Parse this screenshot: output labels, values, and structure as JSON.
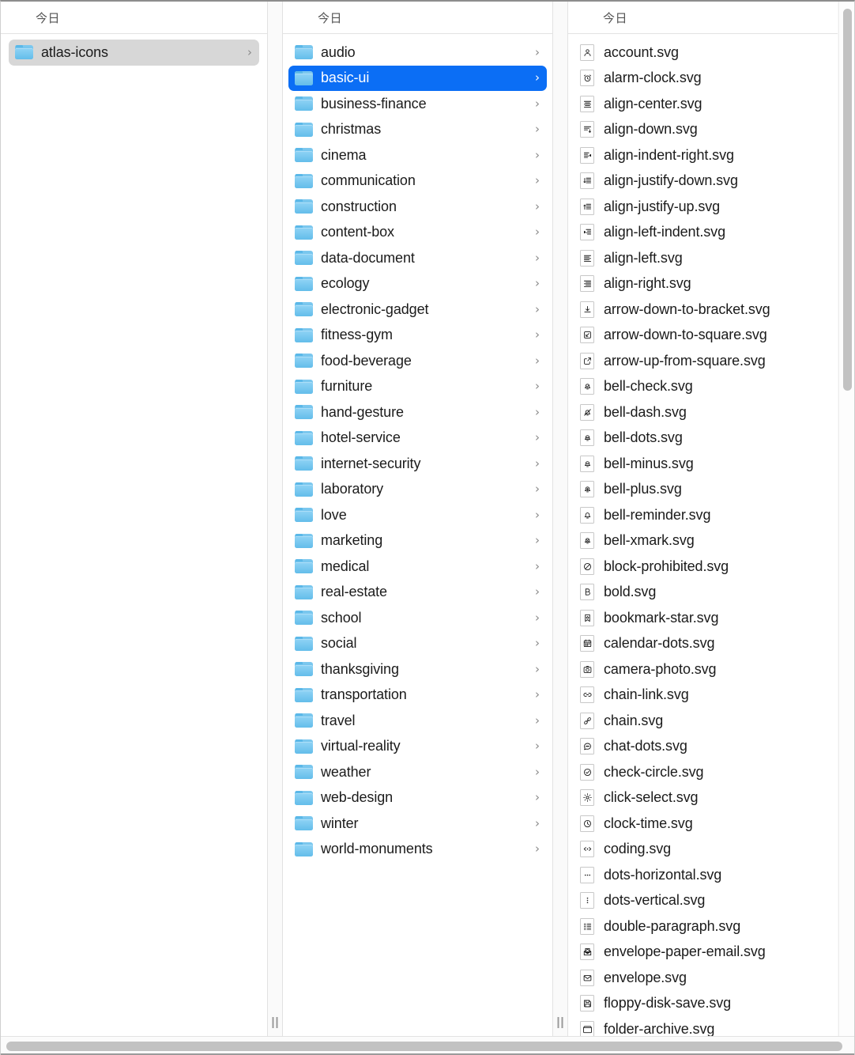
{
  "columns": [
    {
      "header": "今日",
      "kind": "folders",
      "items": [
        {
          "label": "atlas-icons",
          "icon": "folder-icon",
          "chevron": "›",
          "selected": "gray"
        }
      ]
    },
    {
      "header": "今日",
      "kind": "folders",
      "items": [
        {
          "label": "audio",
          "icon": "folder-icon",
          "chevron": "›",
          "selected": "none"
        },
        {
          "label": "basic-ui",
          "icon": "folder-icon",
          "chevron": "›",
          "selected": "blue"
        },
        {
          "label": "business-finance",
          "icon": "folder-icon",
          "chevron": "›",
          "selected": "none"
        },
        {
          "label": "christmas",
          "icon": "folder-icon",
          "chevron": "›",
          "selected": "none"
        },
        {
          "label": "cinema",
          "icon": "folder-icon",
          "chevron": "›",
          "selected": "none"
        },
        {
          "label": "communication",
          "icon": "folder-icon",
          "chevron": "›",
          "selected": "none"
        },
        {
          "label": "construction",
          "icon": "folder-icon",
          "chevron": "›",
          "selected": "none"
        },
        {
          "label": "content-box",
          "icon": "folder-icon",
          "chevron": "›",
          "selected": "none"
        },
        {
          "label": "data-document",
          "icon": "folder-icon",
          "chevron": "›",
          "selected": "none"
        },
        {
          "label": "ecology",
          "icon": "folder-icon",
          "chevron": "›",
          "selected": "none"
        },
        {
          "label": "electronic-gadget",
          "icon": "folder-icon",
          "chevron": "›",
          "selected": "none"
        },
        {
          "label": "fitness-gym",
          "icon": "folder-icon",
          "chevron": "›",
          "selected": "none"
        },
        {
          "label": "food-beverage",
          "icon": "folder-icon",
          "chevron": "›",
          "selected": "none"
        },
        {
          "label": "furniture",
          "icon": "folder-icon",
          "chevron": "›",
          "selected": "none"
        },
        {
          "label": "hand-gesture",
          "icon": "folder-icon",
          "chevron": "›",
          "selected": "none"
        },
        {
          "label": "hotel-service",
          "icon": "folder-icon",
          "chevron": "›",
          "selected": "none"
        },
        {
          "label": "internet-security",
          "icon": "folder-icon",
          "chevron": "›",
          "selected": "none"
        },
        {
          "label": "laboratory",
          "icon": "folder-icon",
          "chevron": "›",
          "selected": "none"
        },
        {
          "label": "love",
          "icon": "folder-icon",
          "chevron": "›",
          "selected": "none"
        },
        {
          "label": "marketing",
          "icon": "folder-icon",
          "chevron": "›",
          "selected": "none"
        },
        {
          "label": "medical",
          "icon": "folder-icon",
          "chevron": "›",
          "selected": "none"
        },
        {
          "label": "real-estate",
          "icon": "folder-icon",
          "chevron": "›",
          "selected": "none"
        },
        {
          "label": "school",
          "icon": "folder-icon",
          "chevron": "›",
          "selected": "none"
        },
        {
          "label": "social",
          "icon": "folder-icon",
          "chevron": "›",
          "selected": "none"
        },
        {
          "label": "thanksgiving",
          "icon": "folder-icon",
          "chevron": "›",
          "selected": "none"
        },
        {
          "label": "transportation",
          "icon": "folder-icon",
          "chevron": "›",
          "selected": "none"
        },
        {
          "label": "travel",
          "icon": "folder-icon",
          "chevron": "›",
          "selected": "none"
        },
        {
          "label": "virtual-reality",
          "icon": "folder-icon",
          "chevron": "›",
          "selected": "none"
        },
        {
          "label": "weather",
          "icon": "folder-icon",
          "chevron": "›",
          "selected": "none"
        },
        {
          "label": "web-design",
          "icon": "folder-icon",
          "chevron": "›",
          "selected": "none"
        },
        {
          "label": "winter",
          "icon": "folder-icon",
          "chevron": "›",
          "selected": "none"
        },
        {
          "label": "world-monuments",
          "icon": "folder-icon",
          "chevron": "›",
          "selected": "none"
        }
      ]
    },
    {
      "header": "今日",
      "kind": "files",
      "items": [
        {
          "label": "account.svg",
          "icon": "account-icon",
          "selected": "none"
        },
        {
          "label": "alarm-clock.svg",
          "icon": "alarm-clock-icon",
          "selected": "none"
        },
        {
          "label": "align-center.svg",
          "icon": "align-center-icon",
          "selected": "none"
        },
        {
          "label": "align-down.svg",
          "icon": "align-down-icon",
          "selected": "none"
        },
        {
          "label": "align-indent-right.svg",
          "icon": "align-indent-right-icon",
          "selected": "none"
        },
        {
          "label": "align-justify-down.svg",
          "icon": "align-justify-down-icon",
          "selected": "none"
        },
        {
          "label": "align-justify-up.svg",
          "icon": "align-justify-up-icon",
          "selected": "none"
        },
        {
          "label": "align-left-indent.svg",
          "icon": "align-left-indent-icon",
          "selected": "none"
        },
        {
          "label": "align-left.svg",
          "icon": "align-left-icon",
          "selected": "none"
        },
        {
          "label": "align-right.svg",
          "icon": "align-right-icon",
          "selected": "none"
        },
        {
          "label": "arrow-down-to-bracket.svg",
          "icon": "arrow-down-to-bracket-icon",
          "selected": "none"
        },
        {
          "label": "arrow-down-to-square.svg",
          "icon": "arrow-down-to-square-icon",
          "selected": "none"
        },
        {
          "label": "arrow-up-from-square.svg",
          "icon": "arrow-up-from-square-icon",
          "selected": "none"
        },
        {
          "label": "bell-check.svg",
          "icon": "bell-check-icon",
          "selected": "none"
        },
        {
          "label": "bell-dash.svg",
          "icon": "bell-dash-icon",
          "selected": "none"
        },
        {
          "label": "bell-dots.svg",
          "icon": "bell-dots-icon",
          "selected": "none"
        },
        {
          "label": "bell-minus.svg",
          "icon": "bell-minus-icon",
          "selected": "none"
        },
        {
          "label": "bell-plus.svg",
          "icon": "bell-plus-icon",
          "selected": "none"
        },
        {
          "label": "bell-reminder.svg",
          "icon": "bell-reminder-icon",
          "selected": "none"
        },
        {
          "label": "bell-xmark.svg",
          "icon": "bell-xmark-icon",
          "selected": "none"
        },
        {
          "label": "block-prohibited.svg",
          "icon": "block-prohibited-icon",
          "selected": "none"
        },
        {
          "label": "bold.svg",
          "icon": "bold-icon",
          "selected": "none"
        },
        {
          "label": "bookmark-star.svg",
          "icon": "bookmark-star-icon",
          "selected": "none"
        },
        {
          "label": "calendar-dots.svg",
          "icon": "calendar-dots-icon",
          "selected": "none"
        },
        {
          "label": "camera-photo.svg",
          "icon": "camera-photo-icon",
          "selected": "none"
        },
        {
          "label": "chain-link.svg",
          "icon": "chain-link-icon",
          "selected": "none"
        },
        {
          "label": "chain.svg",
          "icon": "chain-icon",
          "selected": "none"
        },
        {
          "label": "chat-dots.svg",
          "icon": "chat-dots-icon",
          "selected": "none"
        },
        {
          "label": "check-circle.svg",
          "icon": "check-circle-icon",
          "selected": "none"
        },
        {
          "label": "click-select.svg",
          "icon": "click-select-icon",
          "selected": "none"
        },
        {
          "label": "clock-time.svg",
          "icon": "clock-time-icon",
          "selected": "none"
        },
        {
          "label": "coding.svg",
          "icon": "coding-icon",
          "selected": "none"
        },
        {
          "label": "dots-horizontal.svg",
          "icon": "dots-horizontal-icon",
          "selected": "none"
        },
        {
          "label": "dots-vertical.svg",
          "icon": "dots-vertical-icon",
          "selected": "none"
        },
        {
          "label": "double-paragraph.svg",
          "icon": "double-paragraph-icon",
          "selected": "none"
        },
        {
          "label": "envelope-paper-email.svg",
          "icon": "envelope-paper-email-icon",
          "selected": "none"
        },
        {
          "label": "envelope.svg",
          "icon": "envelope-icon",
          "selected": "none"
        },
        {
          "label": "floppy-disk-save.svg",
          "icon": "floppy-disk-save-icon",
          "selected": "none"
        },
        {
          "label": "folder-archive.svg",
          "icon": "folder-archive-icon",
          "selected": "none"
        }
      ]
    }
  ],
  "colors": {
    "selection_blue": "#0b6ef5",
    "selection_gray": "#d7d7d7",
    "folder_blue": "#63bdea",
    "text": "#1b1b1b",
    "header_text": "#535353",
    "scrollbar_thumb": "#c2c2c2"
  },
  "scrollbars": {
    "vertical_present": true,
    "horizontal_present": true
  }
}
